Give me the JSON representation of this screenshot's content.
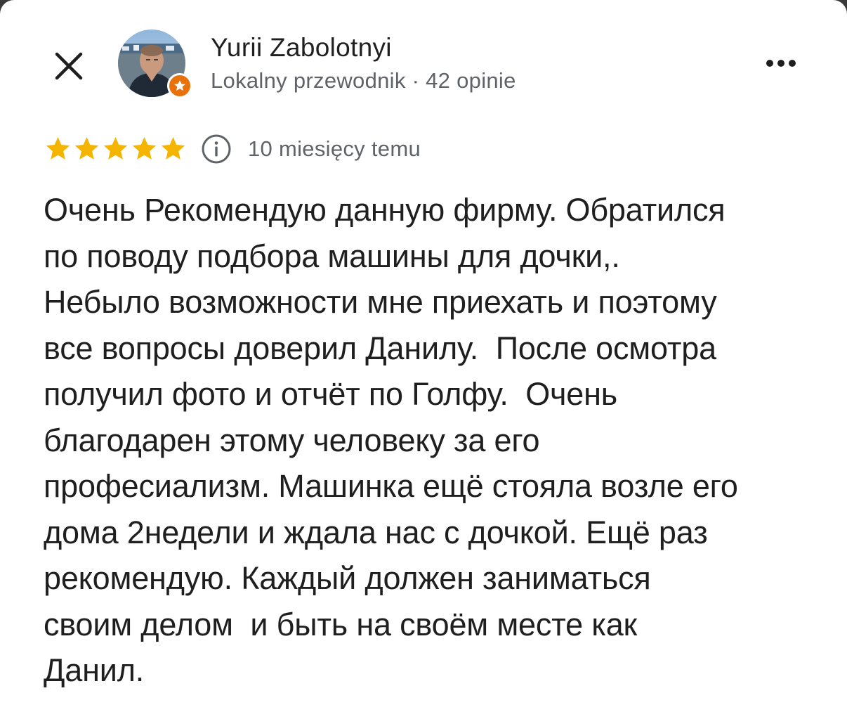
{
  "header": {
    "close_icon": "close-icon",
    "more_icon": "more-horizontal-icon"
  },
  "author": {
    "name": "Yurii Zabolotnyi",
    "meta": "Lokalny przewodnik · 42 opinie",
    "badge_icon": "local-guide-star-icon",
    "badge_color": "#e8710a"
  },
  "rating": {
    "stars": 5,
    "max_stars": 5,
    "star_color": "#f4b400",
    "info_icon": "info-icon",
    "time_ago": "10 miesięcy temu"
  },
  "review": {
    "text": "Очень Рекомендую данную фирму. Обратился\nпо поводу подбора машины для дочки,.\nНебыло возможности мне приехать и поэтому\nвсе вопросы доверил Данилу.  После осмотра\nполучил фото и отчёт по Голфу.  Очень\nблагодарен этому человеку за его\nпрофесиализм. Машинка ещё стояла возле его\nдома 2недели и ждала нас с дочкой. Ещё раз\nрекомендую. Каждый должен заниматься\nсвоим делом  и быть на своём месте как\nДанил."
  }
}
